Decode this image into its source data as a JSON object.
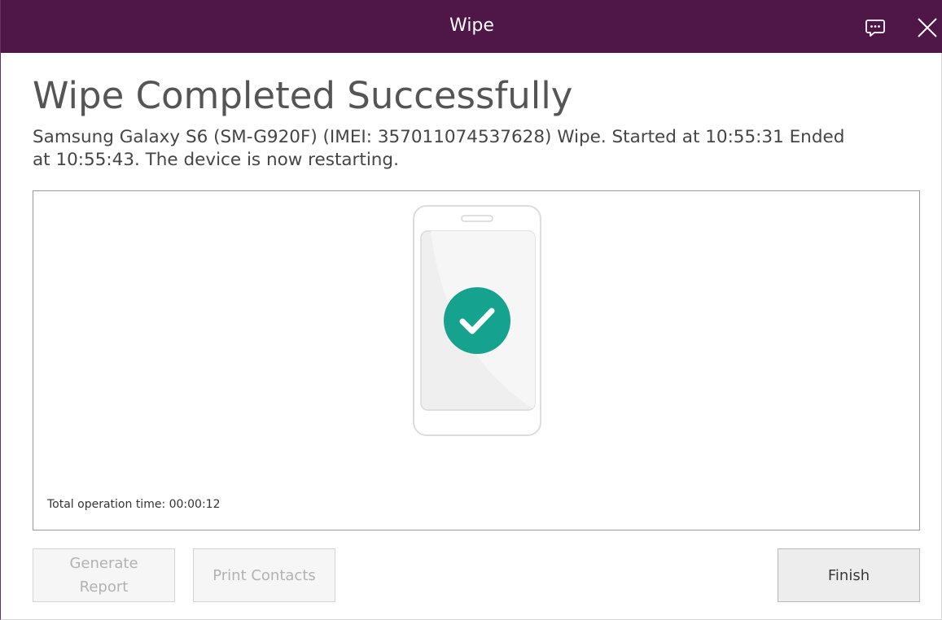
{
  "window": {
    "title": "Wipe"
  },
  "titlebar": {
    "icons": [
      "feedback-icon",
      "close-icon"
    ]
  },
  "result": {
    "heading": "Wipe Completed Successfully",
    "summary_line1": "Samsung Galaxy S6 (SM-G920F) (IMEI: 357011074537628) Wipe. Started at 10:55:31 Ended",
    "summary_line2": "at 10:55:43. The device is now restarting.",
    "status_icon": "check-circle-icon",
    "operation_time": "Total operation time: 00:00:12"
  },
  "buttons": {
    "generate_report": "Generate Report",
    "print_contacts": "Print Contacts",
    "finish": "Finish"
  },
  "colors": {
    "titlebar": "#4f1747",
    "success": "#15a38f",
    "disabled_text": "#b2b2b2"
  }
}
